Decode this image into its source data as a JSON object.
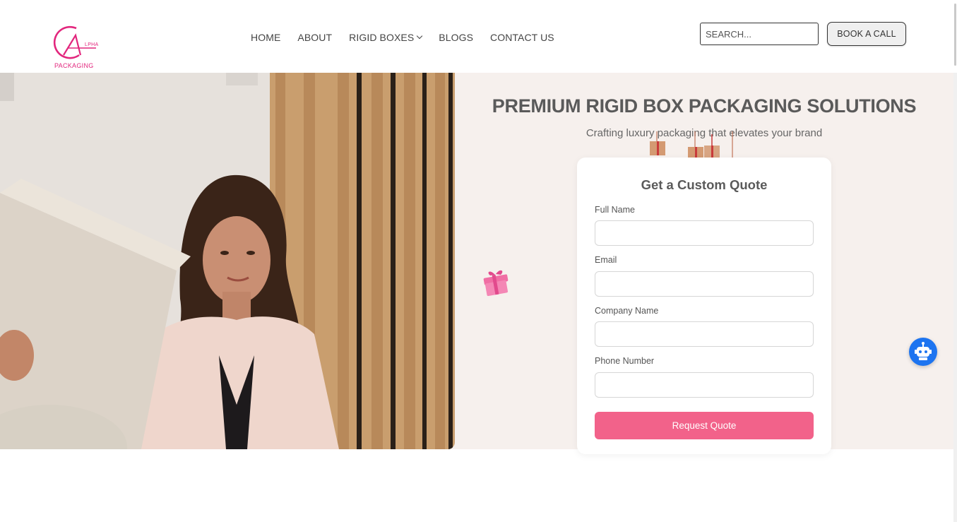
{
  "header": {
    "logo": {
      "name": "alpha-packaging-logo",
      "sup_text": "LPHA",
      "text": "PACKAGING"
    },
    "nav": [
      {
        "label": "HOME",
        "has_dropdown": false
      },
      {
        "label": "ABOUT",
        "has_dropdown": false
      },
      {
        "label": "RIGID BOXES",
        "has_dropdown": true
      },
      {
        "label": "BLOGS",
        "has_dropdown": false
      },
      {
        "label": "CONTACT US",
        "has_dropdown": false
      }
    ],
    "search": {
      "placeholder": "SEARCH...",
      "value": ""
    },
    "book_call_label": "BOOK A CALL"
  },
  "hero": {
    "title": "PREMIUM RIGID BOX PACKAGING SOLUTIONS",
    "subtitle": "Crafting luxury packaging that elevates your brand"
  },
  "quote_form": {
    "title": "Get a Custom Quote",
    "fields": [
      {
        "label": "Full Name",
        "value": ""
      },
      {
        "label": "Email",
        "value": ""
      },
      {
        "label": "Company Name",
        "value": ""
      },
      {
        "label": "Phone Number",
        "value": ""
      }
    ],
    "submit_label": "Request Quote"
  },
  "colors": {
    "brand_pink": "#e2267d",
    "button_pink": "#f2628a",
    "hero_bg": "#f6f0ed",
    "chatbot_blue": "#1d74f0"
  },
  "icons": [
    "chevron-down-icon",
    "gift-icon",
    "hanging-gifts-icon",
    "chatbot-icon"
  ]
}
